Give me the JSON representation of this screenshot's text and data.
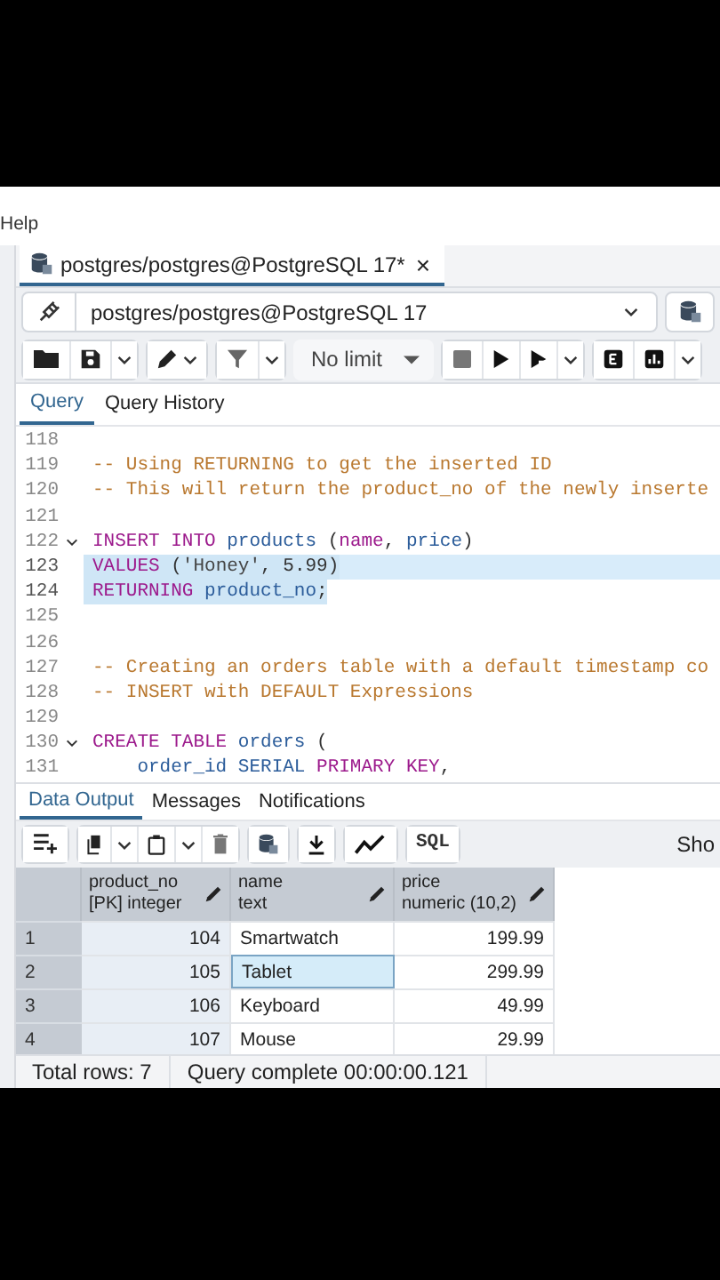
{
  "menu": {
    "items": [
      "Help"
    ]
  },
  "doc_tabs": [
    {
      "label": "postgres/postgres@PostgreSQL 17*",
      "selected": true,
      "close": "×"
    }
  ],
  "connection": {
    "value": "postgres/postgres@PostgreSQL 17"
  },
  "toolbar": {
    "limit": "No limit"
  },
  "editor_tabs": [
    {
      "label": "Query",
      "selected": true
    },
    {
      "label": "Query History",
      "selected": false
    }
  ],
  "code_lines": [
    {
      "number": "118",
      "fold": false,
      "active": false,
      "selected": false
    },
    {
      "number": "119",
      "fold": false,
      "active": false,
      "selected": false,
      "tokens": [
        {
          "kind": "comment",
          "text": "-- Using RETURNING to get the inserted ID"
        }
      ]
    },
    {
      "number": "120",
      "fold": false,
      "active": false,
      "selected": false,
      "tokens": [
        {
          "kind": "comment",
          "text": "-- This will return the product_no of the newly inserte"
        }
      ]
    },
    {
      "number": "121",
      "fold": false,
      "active": false,
      "selected": false
    },
    {
      "number": "122",
      "fold": true,
      "active": false,
      "selected": false,
      "tokens": [
        {
          "kind": "keyword",
          "text": "INSERT INTO "
        },
        {
          "kind": "ident",
          "text": "products"
        },
        {
          "kind": "plain",
          "text": " ("
        },
        {
          "kind": "keyword",
          "text": "name"
        },
        {
          "kind": "plain",
          "text": ", "
        },
        {
          "kind": "ident",
          "text": "price"
        },
        {
          "kind": "plain",
          "text": ")"
        }
      ]
    },
    {
      "number": "123",
      "fold": false,
      "active": true,
      "selected": true,
      "tokens": [
        {
          "kind": "keyword",
          "text": "VALUES"
        },
        {
          "kind": "plain",
          "text": " ("
        },
        {
          "kind": "string",
          "text": "'Honey'"
        },
        {
          "kind": "plain",
          "text": ", "
        },
        {
          "kind": "number",
          "text": "5.99"
        },
        {
          "kind": "plain",
          "text": ")"
        }
      ]
    },
    {
      "number": "124",
      "fold": false,
      "active": false,
      "selected": true,
      "tokens": [
        {
          "kind": "keyword",
          "text": "RETURNING "
        },
        {
          "kind": "ident",
          "text": "product_no"
        },
        {
          "kind": "plain",
          "text": ";"
        }
      ]
    },
    {
      "number": "125",
      "fold": false,
      "active": false,
      "selected": false
    },
    {
      "number": "126",
      "fold": false,
      "active": false,
      "selected": false
    },
    {
      "number": "127",
      "fold": false,
      "active": false,
      "selected": false,
      "tokens": [
        {
          "kind": "comment",
          "text": "-- Creating an orders table with a default timestamp co"
        }
      ]
    },
    {
      "number": "128",
      "fold": false,
      "active": false,
      "selected": false,
      "tokens": [
        {
          "kind": "comment",
          "text": "-- INSERT with DEFAULT Expressions"
        }
      ]
    },
    {
      "number": "129",
      "fold": false,
      "active": false,
      "selected": false
    },
    {
      "number": "130",
      "fold": true,
      "active": false,
      "selected": false,
      "tokens": [
        {
          "kind": "keyword",
          "text": "CREATE TABLE "
        },
        {
          "kind": "ident",
          "text": "orders"
        },
        {
          "kind": "plain",
          "text": " ("
        }
      ]
    },
    {
      "number": "131",
      "fold": false,
      "active": false,
      "selected": false,
      "tokens": [
        {
          "kind": "ident",
          "text": "    order_id SERIAL "
        },
        {
          "kind": "keyword",
          "text": "PRIMARY KEY"
        },
        {
          "kind": "plain",
          "text": ","
        }
      ]
    }
  ],
  "result_tabs": [
    {
      "label": "Data Output",
      "selected": true
    },
    {
      "label": "Messages",
      "selected": false
    },
    {
      "label": "Notifications",
      "selected": false
    }
  ],
  "result_toolbar": {
    "sql_button": "SQL",
    "cut_text": "Sho"
  },
  "table": {
    "columns": [
      {
        "name": "product_no",
        "type": "[PK] integer"
      },
      {
        "name": "name",
        "type": "text"
      },
      {
        "name": "price",
        "type": "numeric (10,2)"
      }
    ],
    "rows": [
      {
        "index": "1",
        "cells": [
          {
            "text": "104",
            "selected": false
          },
          {
            "text": "Smartwatch",
            "selected": false
          },
          {
            "text": "199.99",
            "selected": false
          }
        ]
      },
      {
        "index": "2",
        "cells": [
          {
            "text": "105",
            "selected": false
          },
          {
            "text": "Tablet",
            "selected": true
          },
          {
            "text": "299.99",
            "selected": false
          }
        ]
      },
      {
        "index": "3",
        "cells": [
          {
            "text": "106",
            "selected": false
          },
          {
            "text": "Keyboard",
            "selected": false
          },
          {
            "text": "49.99",
            "selected": false
          }
        ]
      },
      {
        "index": "4",
        "cells": [
          {
            "text": "107",
            "selected": false
          },
          {
            "text": "Mouse",
            "selected": false
          },
          {
            "text": "29.99",
            "selected": false
          }
        ]
      }
    ]
  },
  "status_bar": {
    "rows": "Total rows: 7",
    "message": "Query complete 00:00:00.121"
  }
}
